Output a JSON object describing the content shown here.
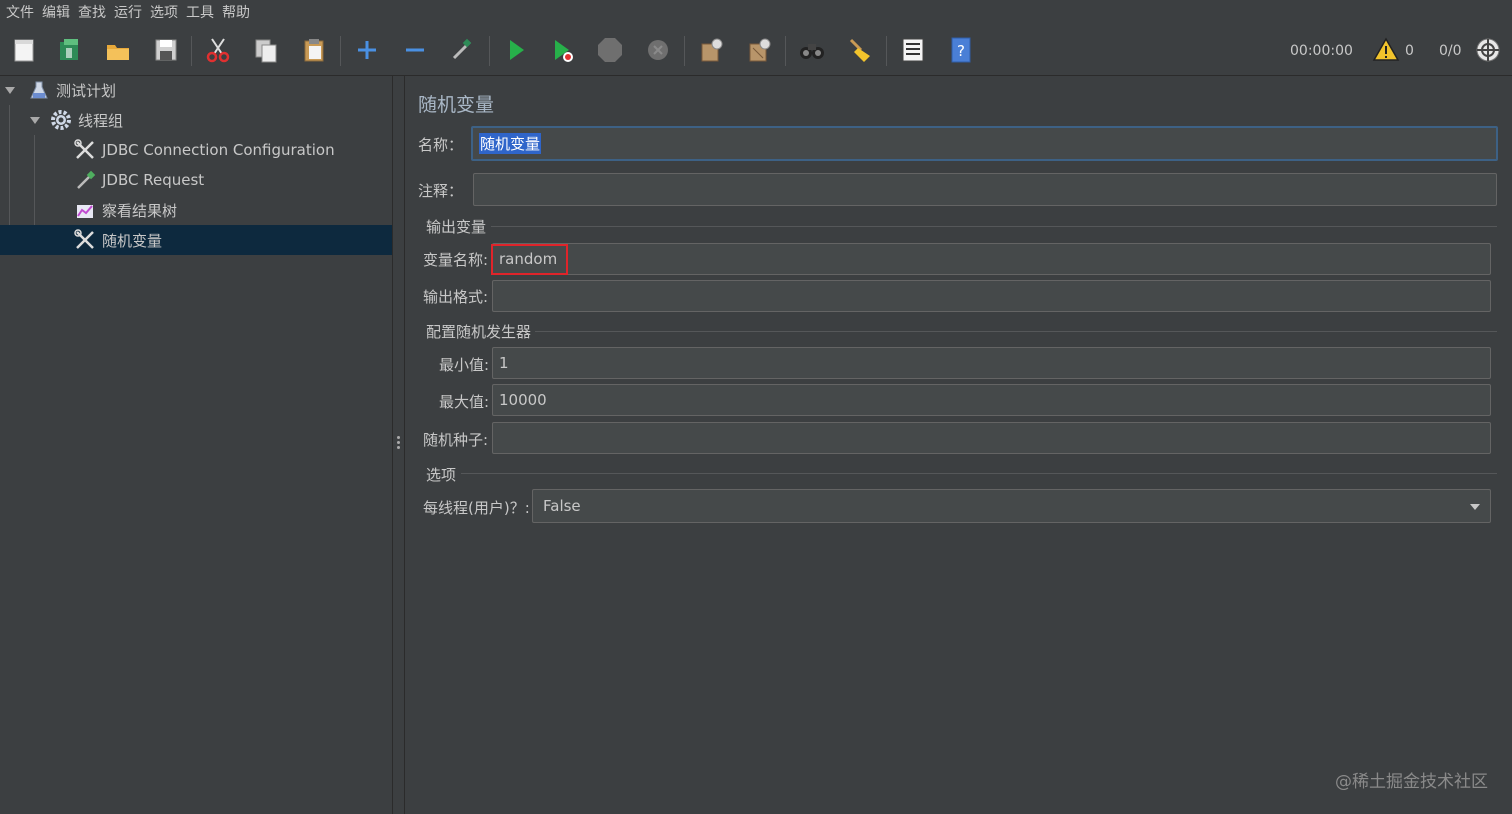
{
  "menu": [
    "文件",
    "编辑",
    "查找",
    "运行",
    "选项",
    "工具",
    "帮助"
  ],
  "toolbar": {
    "timer": "00:00:00",
    "warnings": "0",
    "threads": "0/0"
  },
  "tree": {
    "items": [
      {
        "label": "测试计划",
        "icon": "test-plan-icon"
      },
      {
        "label": "线程组",
        "icon": "thread-group-gear-icon"
      },
      {
        "label": "JDBC Connection Configuration",
        "icon": "config-tools-icon"
      },
      {
        "label": "JDBC Request",
        "icon": "sampler-pipette-icon"
      },
      {
        "label": "察看结果树",
        "icon": "listener-graph-icon"
      },
      {
        "label": "随机变量",
        "icon": "config-tools-icon"
      }
    ]
  },
  "panel": {
    "title": "随机变量",
    "name_label": "名称：",
    "name_value": "随机变量",
    "comment_label": "注释：",
    "comment_value": "",
    "output_group": "输出变量",
    "var_name_label": "变量名称:",
    "var_name_value": "random",
    "output_format_label": "输出格式:",
    "output_format_value": "",
    "generator_group": "配置随机发生器",
    "min_label": "最小值:",
    "min_value": "1",
    "max_label": "最大值:",
    "max_value": "10000",
    "seed_label": "随机种子:",
    "seed_value": "",
    "options_group": "选项",
    "per_thread_label": "每线程(用户)？:",
    "per_thread_value": "False"
  },
  "watermark": "@稀土掘金技术社区",
  "colors": {
    "background": "#3c3f41",
    "selection": "#0d293e",
    "highlight": "#e0242a",
    "accent_blue": "#2f65ca"
  }
}
